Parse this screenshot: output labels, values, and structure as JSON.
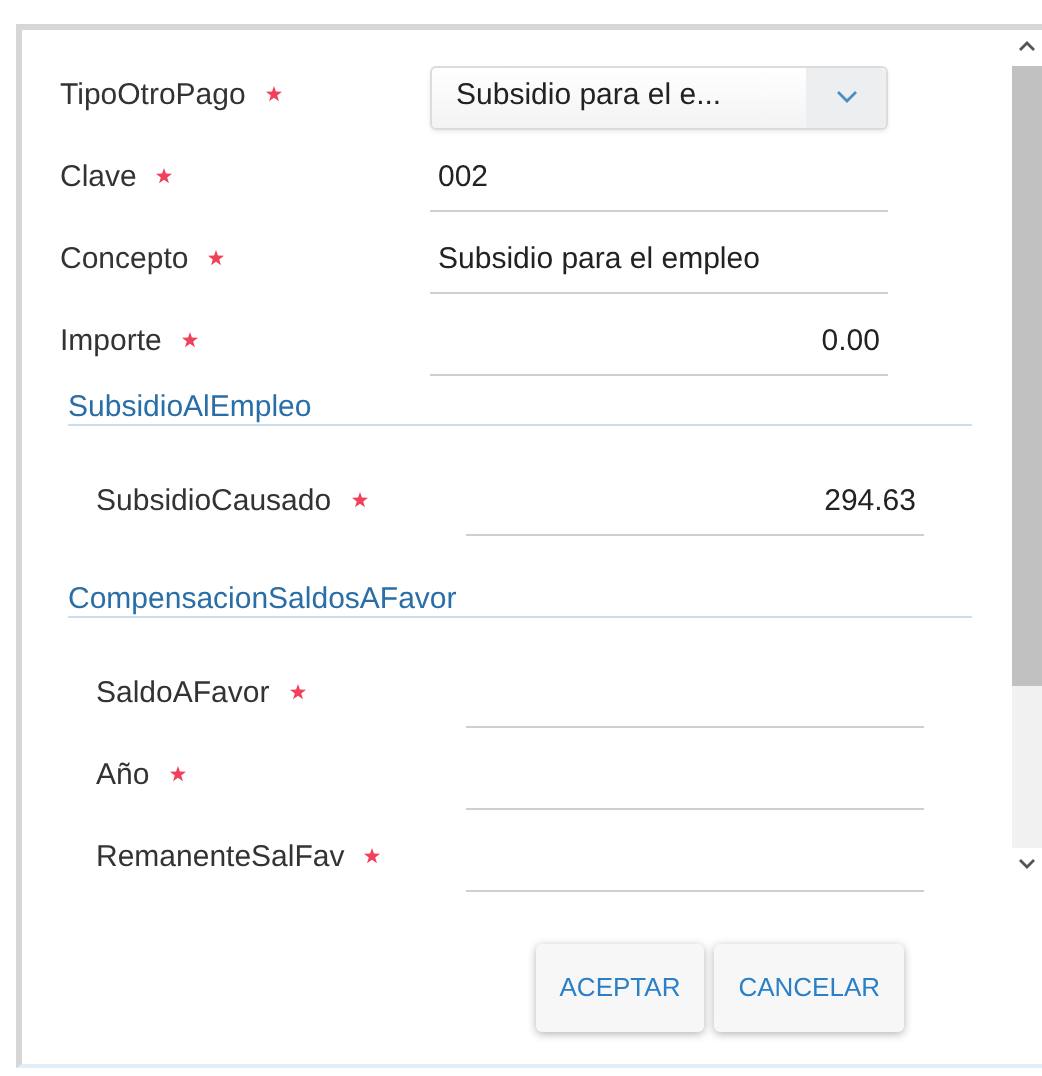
{
  "fields": [
    {
      "kind": "select",
      "label": "TipoOtroPago",
      "required": true,
      "value": "Subsidio para el e..."
    },
    {
      "kind": "text",
      "label": "Clave",
      "required": true,
      "value": "002"
    },
    {
      "kind": "text",
      "label": "Concepto",
      "required": true,
      "value": "Subsidio para el empleo"
    },
    {
      "kind": "amount",
      "label": "Importe",
      "required": true,
      "value": "0.00"
    }
  ],
  "sections": [
    {
      "title": "SubsidioAlEmpleo",
      "fields": [
        {
          "kind": "amount",
          "label": "SubsidioCausado",
          "required": true,
          "value": "294.63"
        }
      ]
    },
    {
      "title": "CompensacionSaldosAFavor",
      "fields": [
        {
          "kind": "text",
          "label": "SaldoAFavor",
          "required": true
        },
        {
          "kind": "text",
          "label": "Año",
          "required": true
        },
        {
          "kind": "text",
          "label": "RemanenteSalFav",
          "required": true
        }
      ]
    }
  ],
  "buttons": [
    "ACEPTAR",
    "CANCELAR"
  ]
}
